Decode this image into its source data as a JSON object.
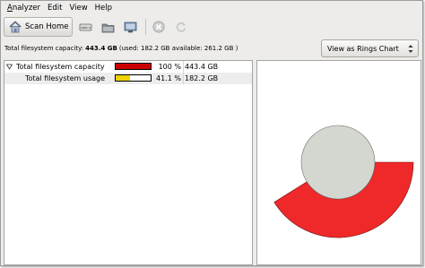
{
  "menubar": {
    "items": [
      "Analyzer",
      "Edit",
      "View",
      "Help"
    ]
  },
  "toolbar": {
    "scan_home_label": "Scan Home",
    "icons": [
      "home-icon",
      "drive-icon",
      "folder-icon",
      "network-folder-icon",
      "stop-icon",
      "refresh-icon"
    ]
  },
  "info": {
    "prefix": "Total filesystem capacity:",
    "capacity": "443.4 GB",
    "detail": "(used: 182.2 GB available: 261.2 GB )"
  },
  "view_combo": {
    "selected": "View as Rings Chart"
  },
  "tree": {
    "rows": [
      {
        "name": "Total filesystem capacity",
        "percent": "100 %",
        "size": "443.4 GB",
        "fill_fraction": 1.0,
        "fill_color": "#cc0000"
      },
      {
        "name": "Total filesystem usage",
        "percent": "41.1 %",
        "size": "182.2 GB",
        "fill_fraction": 0.411,
        "fill_color": "#edd400"
      }
    ]
  },
  "rings_chart": {
    "center_color": "#d3d7cf",
    "ring_color": "#ef2929",
    "ring_fraction": 0.411
  }
}
